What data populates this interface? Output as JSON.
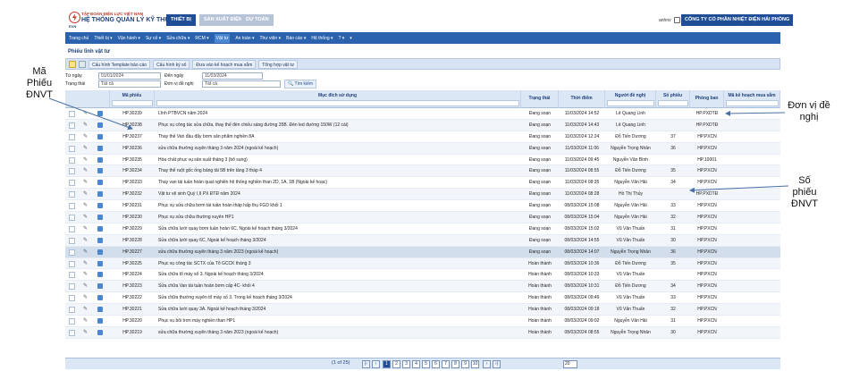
{
  "header": {
    "corp": "TẬP ĐOÀN ĐIỆN LỰC VIỆT NAM",
    "system": "HỆ THỐNG QUẢN LÝ KỸ THUẬT",
    "evn": "EVN",
    "tabs": [
      "THIẾT BỊ",
      "SẢN XUẤT ĐIỆN",
      "DỰ TOÁN"
    ],
    "user": "anhnv",
    "company": "CÔNG TY CỔ PHẦN NHIỆT ĐIỆN HẢI PHÒNG"
  },
  "menu": [
    "Trang chủ",
    "Thiết bị ▾",
    "Vận hành ▾",
    "Sự cố ▾",
    "Sửa chữa ▾",
    "RCM ▾",
    "Vật tư",
    "An toàn ▾",
    "Thư viện ▾",
    "Báo cáo ▾",
    "Hệ thống ▾",
    "? ▾",
    "▾"
  ],
  "page_title": "Phiếu lĩnh vật tư",
  "toolbar": [
    "Cấu hình Template báo cáo",
    "Cấu hình ký số",
    "Đưa vào kế hoạch mua sắm",
    "Tổng hợp vật tư"
  ],
  "filters": {
    "tu_ngay_label": "Từ ngày",
    "tu_ngay": "01/01/2024",
    "den_ngay_label": "Đến ngày",
    "den_ngay": "11/03/2024",
    "trang_thai_label": "Trạng thái",
    "trang_thai": "Tất cả",
    "don_vi_label": "Đơn vị đề nghị",
    "don_vi": "Tất cả",
    "search": "Tìm kiếm"
  },
  "columns": [
    "Mã phiếu",
    "Mục đích sử dụng",
    "Trạng thái",
    "Thời điểm",
    "Người đề nghị",
    "Số phiếu",
    "Phòng ban",
    "Mã kế hoạch mua sắm"
  ],
  "rows": [
    [
      "HP.30239",
      "Lĩnh PTBVCN năm 2024",
      "Đang soạn",
      "11/03/2024 14:52",
      "Lê Quang Linh",
      "",
      "HP.PXDTĐ"
    ],
    [
      "HP.30238",
      "Phục vụ công tác sửa chữa, thay thế đèn chiếu sáng đường 35B. Đèn led đường 150W (12 cái)",
      "Đang soạn",
      "11/03/2024 14:43",
      "Lê Quang Linh",
      "",
      "HP.PXDTĐ"
    ],
    [
      "HP.30237",
      "Thay thế Van đầu đẩy bơm sản phẩm nghiền 8A",
      "Đang soạn",
      "11/03/2024 12:24",
      "Đỗ Tiến Dương",
      "37",
      "HP.PXCN"
    ],
    [
      "HP.30236",
      "sửa chữa thường xuyên tháng 3 năm 2024 (ngoài kế hoạch)",
      "Đang soạn",
      "11/03/2024 11:06",
      "Nguyễn Trọng Nhân",
      "36",
      "HP.PXCN"
    ],
    [
      "HP.30235",
      "Hóa chất phục vụ sản xuất tháng 3 (bổ sung)",
      "Đang soạn",
      "11/03/2024 09:45",
      "Nguyễn Văn Bình",
      "",
      "HP.10001"
    ],
    [
      "HP.30234",
      "Thay thế ruột gốc ống bảng tải 5B trên tầng 3 tháp 4",
      "Đang soạn",
      "11/03/2024 08:55",
      "Đỗ Tiến Dương",
      "35",
      "HP.PXCN"
    ],
    [
      "HP.30233",
      "Thay van tái tuần hoàn quạt nghiền hệ thống nghiền than 2D, 1A, 1B (Ngoài kế hoạc)",
      "Đang soạn",
      "11/03/2024 08:35",
      "Nguyễn Văn Hải",
      "34",
      "HP.PXCN"
    ],
    [
      "HP.30232",
      "Vật tư vệ sinh Quý I,II PX ĐTĐ năm 2024",
      "Đang soạn",
      "11/03/2024 08:28",
      "Hồ Thị Thủy",
      "",
      "HP.PXDTĐ"
    ],
    [
      "HP.30231",
      "Phục vụ sửa chữa bơm tái tuần hoàn tháp hấp thụ FGD khối 1",
      "Đang soạn",
      "08/03/2024 15:08",
      "Nguyễn Văn Hải",
      "33",
      "HP.PXCN"
    ],
    [
      "HP.30230",
      "Phục vụ sửa chữa thường xuyên HP1",
      "Đang soạn",
      "08/03/2024 15:04",
      "Nguyễn Văn Hải",
      "32",
      "HP.PXCN"
    ],
    [
      "HP.30229",
      "Sửa chữa lưới quay bơm tuần hoàn 6C, Ngoài kế hoạch tháng 3/2024",
      "Đang soạn",
      "08/03/2024 15:02",
      "Vũ Văn Thuấn",
      "31",
      "HP.PXCN"
    ],
    [
      "HP.30228",
      "Sửa chữa lưới quay 6C, Ngoài kế hoạch tháng 3/2024",
      "Đang soạn",
      "08/03/2024 14:55",
      "Vũ Văn Thuấn",
      "30",
      "HP.PXCN"
    ],
    [
      "HP.30227",
      "sửa chữa thường xuyên tháng 3 năm 2023 (ngoài kế hoạch)",
      "Đang soạn",
      "08/03/2024 14:07",
      "Nguyễn Trọng Nhân",
      "36",
      "HP.PXCN"
    ],
    [
      "HP.30225",
      "Phục vụ công tác SCTX của Tổ GCCK tháng 3",
      "Hoàn thành",
      "08/03/2024 10:36",
      "Đỗ Tiến Dương",
      "35",
      "HP.PXCN"
    ],
    [
      "HP.30224",
      "Sửa chữa tổ máy số 3. Ngoài kế hoạch tháng 3/2024",
      "Hoàn thành",
      "08/03/2024 10:33",
      "Vũ Văn Thuấn",
      "",
      "HP.PXCN"
    ],
    [
      "HP.30223",
      "Sửa chữa Van tái tuần hoàn bơm cấp 4C- khối 4",
      "Hoàn thành",
      "08/03/2024 10:31",
      "Đỗ Tiến Dương",
      "34",
      "HP.PXCN"
    ],
    [
      "HP.30222",
      "Sửa chữa thường xuyên tổ máy số 3. Trong kế hoạch tháng 3/2024",
      "Hoàn thành",
      "08/03/2024 09:49",
      "Vũ Văn Thuấn",
      "33",
      "HP.PXCN"
    ],
    [
      "HP.30221",
      "Sửa chữa lưới quay 3A. Ngoài kế hoạch tháng 3/2024",
      "Hoàn thành",
      "08/03/2024 09:18",
      "Vũ Văn Thuấn",
      "32",
      "HP.PXCN"
    ],
    [
      "HP.30220",
      "Phục vụ bôi trơn máy nghiền than HP1",
      "Hoàn thành",
      "08/03/2024 09:02",
      "Nguyễn Văn Hải",
      "31",
      "HP.PXCN"
    ],
    [
      "HP.30219",
      "sửa chữa thường xuyên tháng 3 năm 2023 (ngoài kế hoạch)",
      "Hoàn thành",
      "08/03/2024 08:55",
      "Nguyễn Trọng Nhân",
      "30",
      "HP.PXCN"
    ]
  ],
  "pager": {
    "info": "(1 of 25)",
    "pages": [
      "1",
      "2",
      "3",
      "4",
      "5",
      "6",
      "7",
      "8",
      "9",
      "10"
    ],
    "page_size": "20"
  },
  "annotations": {
    "ma_phieu": "Mã Phiếu ĐNVT",
    "don_vi": "Đơn vị đề nghị",
    "so_phieu": "Số phiếu ĐNVT"
  },
  "colors": {
    "accent": "#1f4e96",
    "menu": "#2a62ad"
  }
}
